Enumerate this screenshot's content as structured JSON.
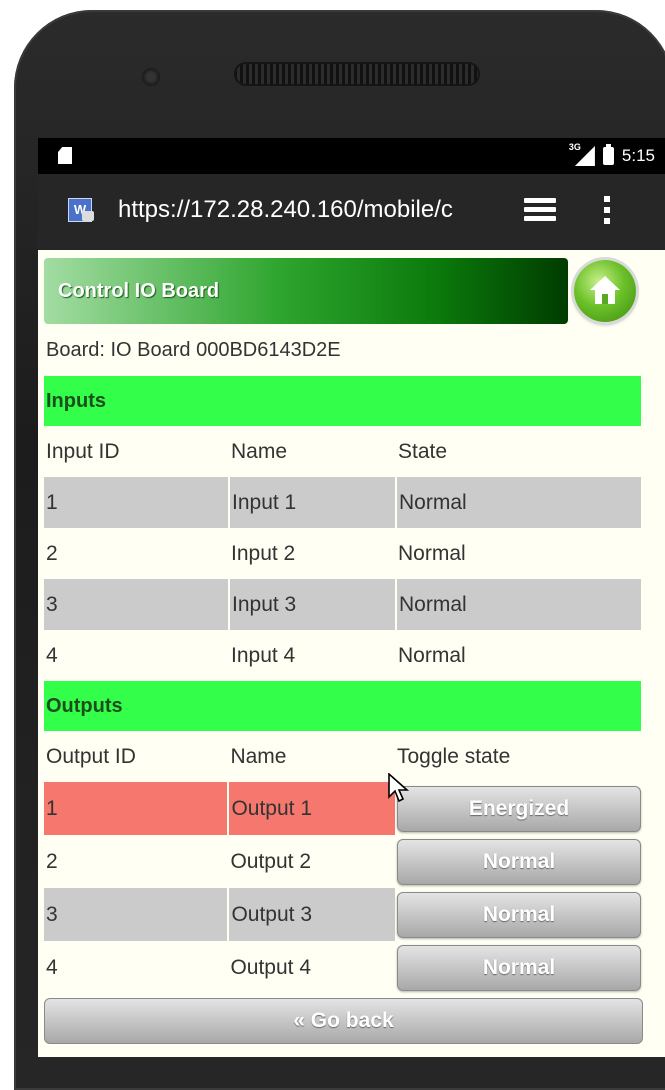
{
  "status_bar": {
    "network": "3G",
    "time": "5:15"
  },
  "browser": {
    "url": "https://172.28.240.160/mobile/c",
    "site_icon_letter": "W"
  },
  "page": {
    "title": "Control IO Board",
    "board_label": "Board: IO Board 000BD6143D2E",
    "inputs": {
      "heading": "Inputs",
      "columns": [
        "Input ID",
        "Name",
        "State"
      ],
      "rows": [
        {
          "id": "1",
          "name": "Input 1",
          "state": "Normal"
        },
        {
          "id": "2",
          "name": "Input 2",
          "state": "Normal"
        },
        {
          "id": "3",
          "name": "Input 3",
          "state": "Normal"
        },
        {
          "id": "4",
          "name": "Input 4",
          "state": "Normal"
        }
      ]
    },
    "outputs": {
      "heading": "Outputs",
      "columns": [
        "Output ID",
        "Name",
        "Toggle state"
      ],
      "rows": [
        {
          "id": "1",
          "name": "Output 1",
          "toggle": "Energized"
        },
        {
          "id": "2",
          "name": "Output 2",
          "toggle": "Normal"
        },
        {
          "id": "3",
          "name": "Output 3",
          "toggle": "Normal"
        },
        {
          "id": "4",
          "name": "Output 4",
          "toggle": "Normal"
        }
      ]
    },
    "go_back": "« Go back"
  },
  "colors": {
    "section_bg": "#33ff4a",
    "energized_row": "#f6776e",
    "shaded_row": "#cbcbcb",
    "page_bg": "#fffff3"
  },
  "icons": [
    "sd-card-icon",
    "signal-icon",
    "battery-icon",
    "site-security-icon",
    "tabs-icon",
    "overflow-menu-icon",
    "home-icon",
    "mouse-cursor-icon"
  ]
}
